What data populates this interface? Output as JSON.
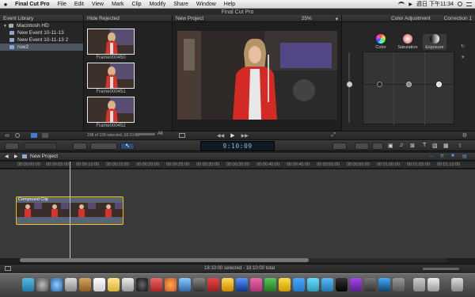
{
  "menubar": {
    "apple": "",
    "items": [
      "Final Cut Pro",
      "File",
      "Edit",
      "View",
      "Mark",
      "Clip",
      "Modify",
      "Share",
      "Window",
      "Help"
    ],
    "clock": "週日 下午11:34"
  },
  "window": {
    "title": "Final Cut Pro"
  },
  "event_library": {
    "header": "Event Library",
    "items": [
      {
        "label": "Macintosh HD"
      },
      {
        "label": "New Event 10-11-13"
      },
      {
        "label": "New Event 10-11-13 2"
      },
      {
        "label": "row2"
      }
    ]
  },
  "browser": {
    "header": "Hide Rejected",
    "frames": [
      "Frame000450",
      "Frame000451",
      "Frame000452"
    ],
    "footer_status": "108 of 109 selected, 18:10:00",
    "footer_filter": "All"
  },
  "viewer": {
    "title": "New Project",
    "zoom": "25%"
  },
  "inspector": {
    "header": "Color Adjustment",
    "correction": "Correction 1",
    "tabs": [
      "Color",
      "Saturation",
      "Exposure"
    ],
    "active_tab": "Exposure"
  },
  "toolbar": {
    "timecode": "9:10:09"
  },
  "timeline": {
    "project_title": "New Project",
    "ruler": [
      "00:00:00:00",
      "00:00:05:00",
      "00:00:10:00",
      "00:00:15:00",
      "00:00:20:00",
      "00:00:25:00",
      "00:00:30:00",
      "00:00:35:00",
      "00:00:40:00",
      "00:00:45:00",
      "00:00:50:00",
      "00:00:55:00",
      "00:01:00:00",
      "00:01:05:00",
      "00:01:10:00"
    ],
    "clip_title": "Compound Clip"
  },
  "status": {
    "text": "18:10:00 selected - 18:10:00 total"
  },
  "colors": {
    "clip_border": "#e8c400",
    "selection": "#4d5560",
    "accent_blue": "#3d7fd4"
  }
}
